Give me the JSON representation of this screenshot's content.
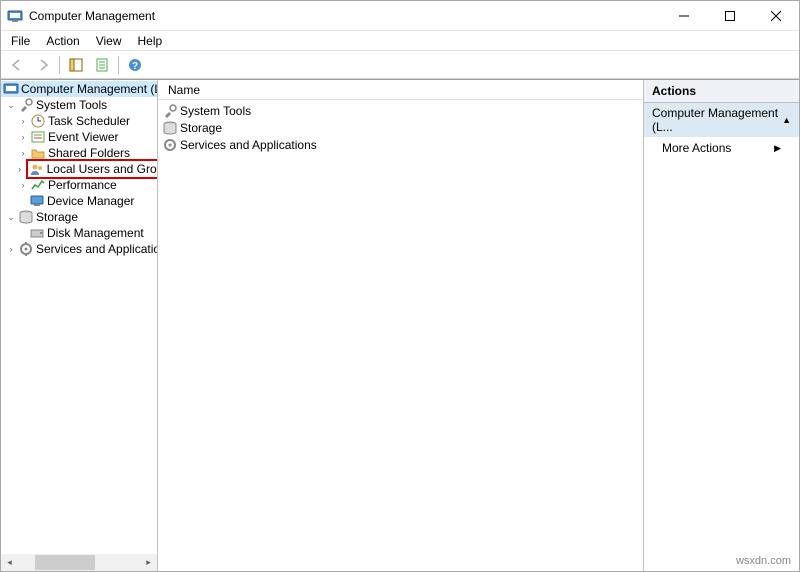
{
  "window": {
    "title": "Computer Management"
  },
  "menubar": {
    "file": "File",
    "action": "Action",
    "view": "View",
    "help": "Help"
  },
  "tree": {
    "root": "Computer Management (Local)",
    "system_tools": "System Tools",
    "task_scheduler": "Task Scheduler",
    "event_viewer": "Event Viewer",
    "shared_folders": "Shared Folders",
    "local_users_groups": "Local Users and Groups",
    "performance": "Performance",
    "device_manager": "Device Manager",
    "storage": "Storage",
    "disk_management": "Disk Management",
    "services_apps": "Services and Applications"
  },
  "list": {
    "header_name": "Name",
    "items": {
      "system_tools": "System Tools",
      "storage": "Storage",
      "services_apps": "Services and Applications"
    }
  },
  "actions": {
    "title": "Actions",
    "group": "Computer Management (L...",
    "more_actions": "More Actions"
  },
  "watermark": "wsxdn.com"
}
